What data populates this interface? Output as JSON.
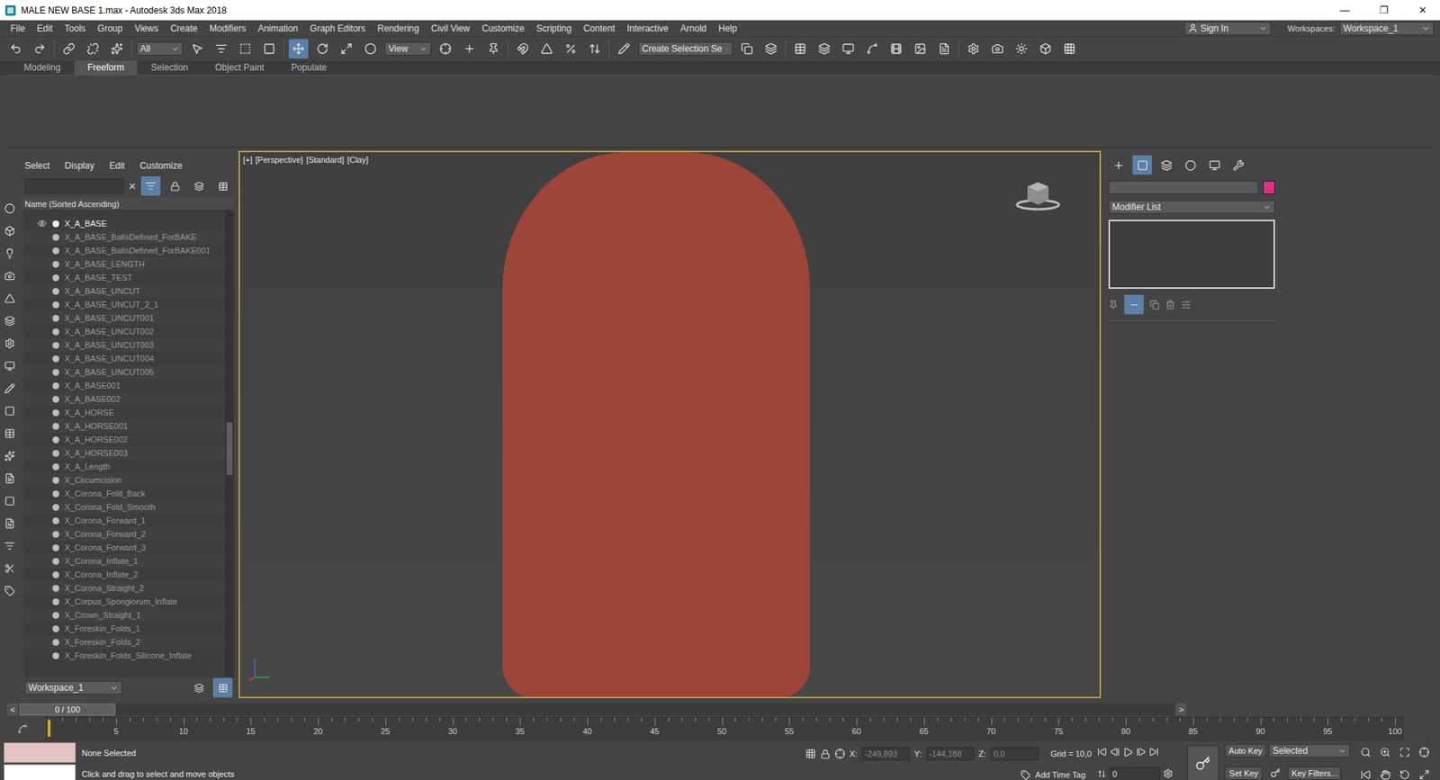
{
  "window": {
    "title": "MALE NEW BASE 1.max - Autodesk 3ds Max 2018",
    "controls": [
      "—",
      "❐",
      "✕"
    ]
  },
  "menu": [
    "File",
    "Edit",
    "Tools",
    "Group",
    "Views",
    "Create",
    "Modifiers",
    "Animation",
    "Graph Editors",
    "Rendering",
    "Civil View",
    "Customize",
    "Scripting",
    "Content",
    "Interactive",
    "Arnold",
    "Help"
  ],
  "account": {
    "sign_in": "Sign In",
    "workspaces_label": "Workspaces:",
    "workspace": "Workspace_1"
  },
  "toolbar": {
    "filter": "All",
    "reference": "View",
    "selection_set": "Create Selection Se"
  },
  "ribbon_tabs": [
    {
      "label": "Modeling",
      "selected": false
    },
    {
      "label": "Freeform",
      "selected": true
    },
    {
      "label": "Selection",
      "selected": false
    },
    {
      "label": "Object Paint",
      "selected": false
    },
    {
      "label": "Populate",
      "selected": false
    }
  ],
  "explorer": {
    "menu": [
      "Select",
      "Display",
      "Edit",
      "Customize"
    ],
    "column": "Name (Sorted Ascending)",
    "clear": "✕",
    "rows": [
      {
        "name": "X_A_BASE",
        "visible": true
      },
      {
        "name": "X_A_BASE_BallsDefined_ForBAKE",
        "visible": false
      },
      {
        "name": "X_A_BASE_BallsDefined_ForBAKE001",
        "visible": false
      },
      {
        "name": "X_A_BASE_LENGTH",
        "visible": false
      },
      {
        "name": "X_A_BASE_TEST",
        "visible": false
      },
      {
        "name": "X_A_BASE_UNCUT",
        "visible": false
      },
      {
        "name": "X_A_BASE_UNCUT_2_1",
        "visible": false
      },
      {
        "name": "X_A_BASE_UNCUT001",
        "visible": false
      },
      {
        "name": "X_A_BASE_UNCUT002",
        "visible": false
      },
      {
        "name": "X_A_BASE_UNCUT003",
        "visible": false
      },
      {
        "name": "X_A_BASE_UNCUT004",
        "visible": false
      },
      {
        "name": "X_A_BASE_UNCUT005",
        "visible": false
      },
      {
        "name": "X_A_BASE001",
        "visible": false
      },
      {
        "name": "X_A_BASE002",
        "visible": false
      },
      {
        "name": "X_A_HORSE",
        "visible": false
      },
      {
        "name": "X_A_HORSE001",
        "visible": false
      },
      {
        "name": "X_A_HORSE002",
        "visible": false
      },
      {
        "name": "X_A_HORSE003",
        "visible": false
      },
      {
        "name": "X_A_Length",
        "visible": false
      },
      {
        "name": "X_Circumcision",
        "visible": false
      },
      {
        "name": "X_Corona_Fold_Back",
        "visible": false
      },
      {
        "name": "X_Corona_Fold_Smooth",
        "visible": false
      },
      {
        "name": "X_Corona_Forward_1",
        "visible": false
      },
      {
        "name": "X_Corona_Forward_2",
        "visible": false
      },
      {
        "name": "X_Corona_Forward_3",
        "visible": false
      },
      {
        "name": "X_Corona_Inflate_1",
        "visible": false
      },
      {
        "name": "X_Corona_Inflate_2",
        "visible": false
      },
      {
        "name": "X_Corona_Straight_2",
        "visible": false
      },
      {
        "name": "X_Corpus_Spongiorum_Inflate",
        "visible": false
      },
      {
        "name": "X_Crown_Straight_1",
        "visible": false
      },
      {
        "name": "X_Foreskin_Folds_1",
        "visible": false
      },
      {
        "name": "X_Foreskin_Folds_2",
        "visible": false
      },
      {
        "name": "X_Foreskin_Folds_Silicone_Inflate",
        "visible": false
      }
    ],
    "workspace": "Workspace_1"
  },
  "viewport": {
    "labels": [
      "[+]",
      "[Perspective]",
      "[Standard]",
      "[Clay]"
    ]
  },
  "command_panel": {
    "tabs": [
      {
        "kind": "create",
        "selected": false
      },
      {
        "kind": "modify",
        "selected": true
      },
      {
        "kind": "hierarchy",
        "selected": false
      },
      {
        "kind": "motion",
        "selected": false
      },
      {
        "kind": "display",
        "selected": false
      },
      {
        "kind": "utilities",
        "selected": false
      }
    ],
    "object_color": "#d63384",
    "modifier_list": "Modifier List"
  },
  "time_slider": {
    "reading": "0 / 100",
    "level": 0,
    "prev": "<",
    "next": ">"
  },
  "track_bar": {
    "frames": 100,
    "current": 0,
    "labels": [
      "5",
      "10",
      "15",
      "20",
      "25",
      "30",
      "35",
      "40",
      "45",
      "50",
      "55",
      "60",
      "65",
      "70",
      "75",
      "80",
      "85",
      "90",
      "95",
      "100"
    ]
  },
  "status": {
    "selection": "None Selected",
    "prompt": "Click and drag to select and move objects",
    "x_label": "X:",
    "x": "-249,893",
    "y_label": "Y:",
    "y": "-144,188",
    "z_label": "Z:",
    "z": "0,0",
    "grid": "Grid = 10,0",
    "add_time_tag": "Add Time Tag",
    "frame": "0",
    "auto_key": "Auto Key",
    "key_mode": "Selected",
    "set_key": "Set Key",
    "key_filters": "Key Filters..."
  }
}
